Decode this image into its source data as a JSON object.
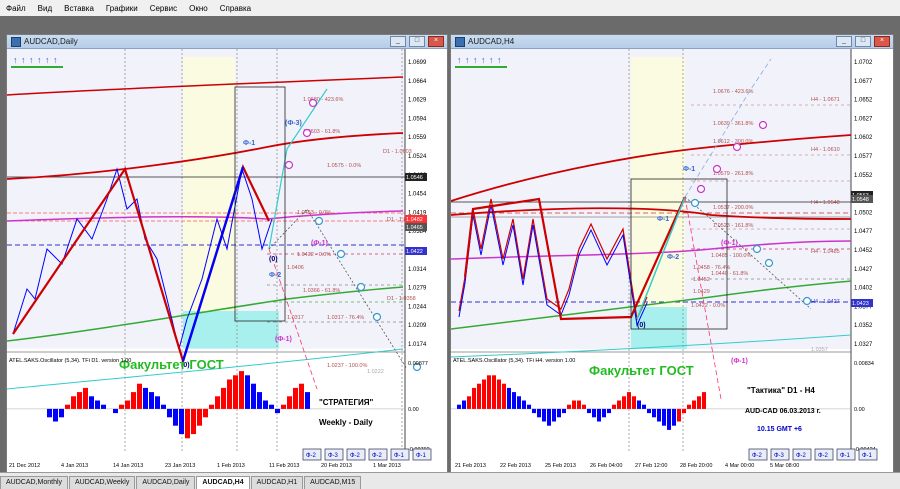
{
  "menu": [
    "Файл",
    "Вид",
    "Вставка",
    "Графики",
    "Сервис",
    "Окно",
    "Справка"
  ],
  "colors": {
    "bg": "#ffffff",
    "up": "#ff0000",
    "down": "#0000ff",
    "ma_red": "#cc0000",
    "ma_green": "#33aa33",
    "ma_purple": "#cc33cc",
    "ma_cyan": "#33cccc",
    "watermark": "#22bb22"
  },
  "left": {
    "title": "AUDCAD,Daily",
    "controls": [
      "_",
      "□",
      "×"
    ],
    "watermark": "Факультет ГОСТ",
    "osc_label": "ATEL.SAKS.Oscillator (5,34). TFi D1. version 1.00",
    "strategy_title": "\"СТРАТЕГИЯ\"",
    "strategy_sub": "Weekly - Daily",
    "buttons": [
      "Ф-2",
      "Ф-3",
      "Ф-2",
      "Ф-2",
      "Ф-1",
      "Ф-1"
    ],
    "price_labels": [
      "1.0699",
      "1.0664",
      "1.0629",
      "1.0594",
      "1.0559",
      "1.0524",
      "1.0489",
      "1.0454",
      "1.0419",
      "1.0384",
      "1.0349",
      "1.0314",
      "1.0279",
      "1.0244",
      "1.0209",
      "1.0174"
    ],
    "price_tags": [
      "1.0546",
      "1.0482",
      "1.0465",
      "1.0422"
    ],
    "osc_labels": [
      "0.00877",
      "0.00",
      "-0.00792"
    ],
    "dates": [
      "21 Dec 2012",
      "4 Jan 2013",
      "14 Jan 2013",
      "23 Jan 2013",
      "1 Feb 2013",
      "11 Feb 2013",
      "20 Feb 2013",
      "1 Mar 2013"
    ],
    "levels": [
      "1.0680 - 423.6%",
      "1.0603 - 61.8%",
      "D1 - 1.0603",
      "1.0575 - 0.0%",
      "1.0453 - 0.0%",
      "D1 - 1.0447",
      "1.0422 - 0.0%",
      "1.0406",
      "1.0366 - 61.8%",
      "D1 - 1.0358",
      "1.0317",
      "1.0317 - 76.4%",
      "1.0237 - 100.0%",
      "1.0222"
    ],
    "fib_marks": [
      "(Ф-3)",
      "Ф-1",
      "(Ф-1)",
      "Ф-2",
      "(0)",
      "(Ф-1)",
      "(0)"
    ]
  },
  "right": {
    "title": "AUDCAD,H4",
    "controls": [
      "_",
      "□",
      "×"
    ],
    "watermark": "Факультет ГОСТ",
    "osc_label": "ATEL.SAKS.Oscillator (5,34). TFi H4. version 1.00",
    "tactics_title": "\"Тактика\"  D1 - H4",
    "tactics_sub": "AUD-CAD      06.03.2013  г.",
    "tactics_time": "10.15  GMT +6",
    "buttons": [
      "Ф-2",
      "Ф-3",
      "Ф-2",
      "Ф-2",
      "Ф-1",
      "Ф-1"
    ],
    "price_labels": [
      "1.0702",
      "1.0677",
      "1.0652",
      "1.0627",
      "1.0602",
      "1.0577",
      "1.0552",
      "1.0527",
      "1.0502",
      "1.0477",
      "1.0452",
      "1.0427",
      "1.0402",
      "1.0377",
      "1.0352",
      "1.0327"
    ],
    "price_tags": [
      "1.0563",
      "1.0548",
      "1.0423"
    ],
    "osc_labels": [
      "0.00834",
      "0.00",
      "-0.00424"
    ],
    "dates": [
      "21 Feb 2013",
      "22 Feb 2013",
      "25 Feb 2013",
      "26 Feb 04:00",
      "27 Feb 12:00",
      "28 Feb 20:00",
      "4 Mar 00:00",
      "5 Mar 08:00"
    ],
    "levels": [
      "1.0676 - 423.6%",
      "H4 - 1.0671",
      "1.0639 - 361.8%",
      "1.0612 - 300.0%",
      "H4 - 1.0610",
      "1.0579 - 261.8%",
      "1.0537 - 200.0%",
      "H4 - 1.0548",
      "1.0523 - 161.8%",
      "1.0485 - 100.0%",
      "H4 - 1.0485",
      "1.0458 - 76.4%",
      "1.0452",
      "1.0440 - 61.8%",
      "1.0429",
      "1.0422 - 0.0%",
      "H4 - 1.0427",
      "1.0357"
    ],
    "fib_marks": [
      "Ф-1",
      "Ф-1",
      "Ф-2",
      "(Ф-1)",
      "(0)",
      "(Ф-1)"
    ]
  },
  "tabs": [
    "AUDCAD,Monthly",
    "AUDCAD,Weekly",
    "AUDCAD,Daily",
    "AUDCAD,H4",
    "AUDCAD,H1",
    "AUDCAD,M15"
  ],
  "active_tab": "AUDCAD,H4"
}
